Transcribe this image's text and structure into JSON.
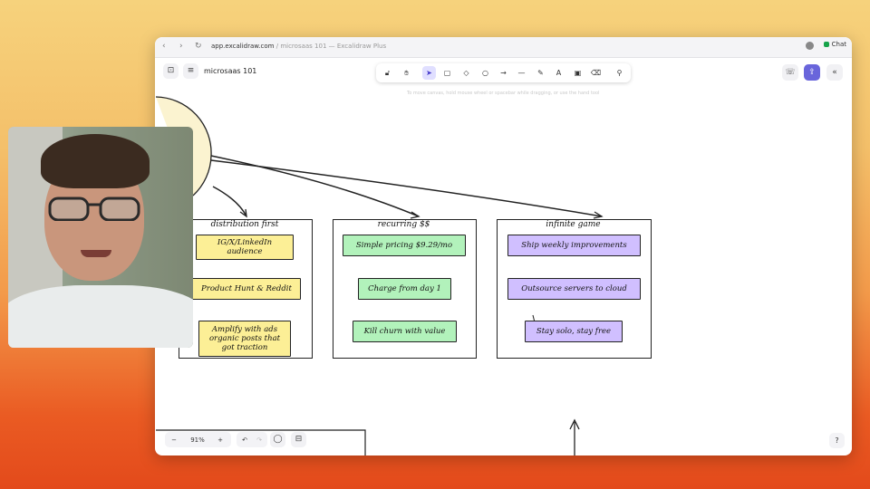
{
  "browser": {
    "url_host": "app.excalidraw.com",
    "url_rest": " / microsaas 101 — Excalidraw Plus",
    "chat_label": "Chat"
  },
  "app": {
    "doc_title": "microsaas 101",
    "hint": "To move canvas, hold mouse wheel or spacebar while dragging, or use the hand tool",
    "zoom_level": "91%"
  },
  "toolbar": {
    "tools": [
      "lock-icon",
      "hand-icon",
      "selection-icon",
      "rectangle-icon",
      "diamond-icon",
      "ellipse-icon",
      "arrow-icon",
      "line-icon",
      "draw-icon",
      "text-icon",
      "image-icon",
      "eraser-icon",
      "more-tools-icon"
    ],
    "active": "selection-icon"
  },
  "frames": [
    {
      "title": "distribution first",
      "color": "#fcef96",
      "notes": [
        "IG/X/LinkedIn audience",
        "Product Hunt & Reddit",
        "Amplify with ads organic posts that got traction"
      ]
    },
    {
      "title": "recurring $$",
      "color": "#b2f2bb",
      "notes": [
        "Simple pricing $9.29/mo",
        "Charge from day 1",
        "Kill churn with value"
      ]
    },
    {
      "title": "infinite game",
      "color": "#d0bfff",
      "notes": [
        "Ship weekly improvements",
        "Outsource servers to cloud",
        "Stay solo, stay free"
      ]
    }
  ]
}
